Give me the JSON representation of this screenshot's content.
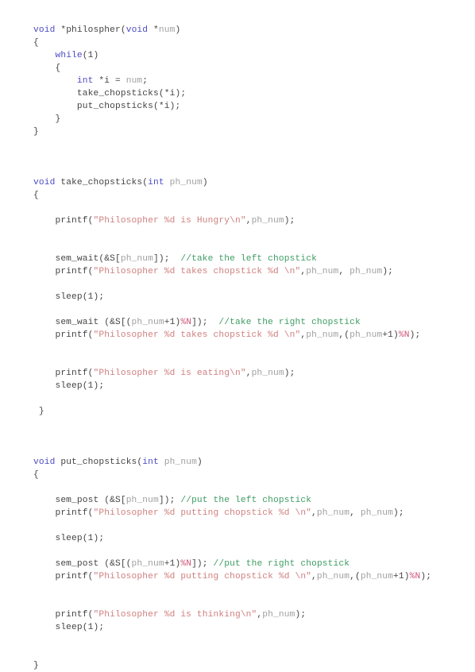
{
  "document": {
    "type": "source-code-listing",
    "language": "C",
    "topic": "Dining Philosophers problem",
    "background_color": "#ffffff",
    "syntax_colors": {
      "keyword": "#4b4bc4",
      "string": "#d08080",
      "comment": "#3e9c63",
      "identifier": "#a0a0a0",
      "plain": "#444444",
      "macro": "#cc5577"
    },
    "font_size_px": 11,
    "line_height_px": 16
  },
  "code": {
    "lines": [
      {
        "id": "l1",
        "tokens": [
          {
            "t": "void",
            "c": "kw"
          },
          {
            "t": " *philospher(",
            "c": "plain"
          },
          {
            "t": "void",
            "c": "kw"
          },
          {
            "t": " *",
            "c": "plain"
          },
          {
            "t": "num",
            "c": "id"
          },
          {
            "t": ")",
            "c": "plain"
          }
        ]
      },
      {
        "id": "l2",
        "tokens": [
          {
            "t": "{",
            "c": "plain"
          }
        ]
      },
      {
        "id": "l3",
        "tokens": [
          {
            "t": "    ",
            "c": "plain"
          },
          {
            "t": "while",
            "c": "kw"
          },
          {
            "t": "(1)",
            "c": "plain"
          }
        ]
      },
      {
        "id": "l4",
        "tokens": [
          {
            "t": "    {",
            "c": "plain"
          }
        ]
      },
      {
        "id": "l5",
        "tokens": [
          {
            "t": "        ",
            "c": "plain"
          },
          {
            "t": "int",
            "c": "kw"
          },
          {
            "t": " *i = ",
            "c": "plain"
          },
          {
            "t": "num",
            "c": "id"
          },
          {
            "t": ";",
            "c": "plain"
          }
        ]
      },
      {
        "id": "l6",
        "tokens": [
          {
            "t": "        take_chopsticks(*i);",
            "c": "plain"
          }
        ]
      },
      {
        "id": "l7",
        "tokens": [
          {
            "t": "        put_chopsticks(*i);",
            "c": "plain"
          }
        ]
      },
      {
        "id": "l8",
        "tokens": [
          {
            "t": "    }",
            "c": "plain"
          }
        ]
      },
      {
        "id": "l9",
        "tokens": [
          {
            "t": "}",
            "c": "plain"
          }
        ]
      },
      {
        "id": "l10",
        "tokens": []
      },
      {
        "id": "l11",
        "tokens": []
      },
      {
        "id": "l12",
        "tokens": []
      },
      {
        "id": "l13",
        "tokens": [
          {
            "t": "void",
            "c": "kw"
          },
          {
            "t": " take_chopsticks(",
            "c": "plain"
          },
          {
            "t": "int",
            "c": "kw"
          },
          {
            "t": " ",
            "c": "plain"
          },
          {
            "t": "ph_num",
            "c": "id"
          },
          {
            "t": ")",
            "c": "plain"
          }
        ]
      },
      {
        "id": "l14",
        "tokens": [
          {
            "t": "{",
            "c": "plain"
          }
        ]
      },
      {
        "id": "l15",
        "tokens": []
      },
      {
        "id": "l16",
        "tokens": [
          {
            "t": "    printf(",
            "c": "plain"
          },
          {
            "t": "\"Philosopher %d is Hungry\\n\"",
            "c": "str"
          },
          {
            "t": ",",
            "c": "plain"
          },
          {
            "t": "ph_num",
            "c": "id"
          },
          {
            "t": ");",
            "c": "plain"
          }
        ]
      },
      {
        "id": "l17",
        "tokens": []
      },
      {
        "id": "l18",
        "tokens": []
      },
      {
        "id": "l19",
        "tokens": [
          {
            "t": "    sem_wait(&S[",
            "c": "plain"
          },
          {
            "t": "ph_num",
            "c": "id"
          },
          {
            "t": "]);  ",
            "c": "plain"
          },
          {
            "t": "//take the left chopstick",
            "c": "cmt"
          }
        ]
      },
      {
        "id": "l20",
        "tokens": [
          {
            "t": "    printf(",
            "c": "plain"
          },
          {
            "t": "\"Philosopher %d takes chopstick %d \\n\"",
            "c": "str"
          },
          {
            "t": ",",
            "c": "plain"
          },
          {
            "t": "ph_num",
            "c": "id"
          },
          {
            "t": ", ",
            "c": "plain"
          },
          {
            "t": "ph_num",
            "c": "id"
          },
          {
            "t": ");",
            "c": "plain"
          }
        ]
      },
      {
        "id": "l21",
        "tokens": []
      },
      {
        "id": "l22",
        "tokens": [
          {
            "t": "    sleep(1);",
            "c": "plain"
          }
        ]
      },
      {
        "id": "l23",
        "tokens": []
      },
      {
        "id": "l24",
        "tokens": [
          {
            "t": "    sem_wait (&S[(",
            "c": "plain"
          },
          {
            "t": "ph_num",
            "c": "id"
          },
          {
            "t": "+1)",
            "c": "plain"
          },
          {
            "t": "%N",
            "c": "macro"
          },
          {
            "t": "]);  ",
            "c": "plain"
          },
          {
            "t": "//take the right chopstick",
            "c": "cmt"
          }
        ]
      },
      {
        "id": "l25",
        "tokens": [
          {
            "t": "    printf(",
            "c": "plain"
          },
          {
            "t": "\"Philosopher %d takes chopstick %d \\n\"",
            "c": "str"
          },
          {
            "t": ",",
            "c": "plain"
          },
          {
            "t": "ph_num",
            "c": "id"
          },
          {
            "t": ",(",
            "c": "plain"
          },
          {
            "t": "ph_num",
            "c": "id"
          },
          {
            "t": "+1)",
            "c": "plain"
          },
          {
            "t": "%N",
            "c": "macro"
          },
          {
            "t": ");",
            "c": "plain"
          }
        ]
      },
      {
        "id": "l26",
        "tokens": []
      },
      {
        "id": "l27",
        "tokens": []
      },
      {
        "id": "l28",
        "tokens": [
          {
            "t": "    printf(",
            "c": "plain"
          },
          {
            "t": "\"Philosopher %d is eating\\n\"",
            "c": "str"
          },
          {
            "t": ",",
            "c": "plain"
          },
          {
            "t": "ph_num",
            "c": "id"
          },
          {
            "t": ");",
            "c": "plain"
          }
        ]
      },
      {
        "id": "l29",
        "tokens": [
          {
            "t": "    sleep(1);",
            "c": "plain"
          }
        ]
      },
      {
        "id": "l30",
        "tokens": []
      },
      {
        "id": "l31",
        "tokens": [
          {
            "t": " }",
            "c": "plain"
          }
        ]
      },
      {
        "id": "l32",
        "tokens": []
      },
      {
        "id": "l33",
        "tokens": []
      },
      {
        "id": "l34",
        "tokens": []
      },
      {
        "id": "l35",
        "tokens": [
          {
            "t": "void",
            "c": "kw"
          },
          {
            "t": " put_chopsticks(",
            "c": "plain"
          },
          {
            "t": "int",
            "c": "kw"
          },
          {
            "t": " ",
            "c": "plain"
          },
          {
            "t": "ph_num",
            "c": "id"
          },
          {
            "t": ")",
            "c": "plain"
          }
        ]
      },
      {
        "id": "l36",
        "tokens": [
          {
            "t": "{",
            "c": "plain"
          }
        ]
      },
      {
        "id": "l37",
        "tokens": []
      },
      {
        "id": "l38",
        "tokens": [
          {
            "t": "    sem_post (&S[",
            "c": "plain"
          },
          {
            "t": "ph_num",
            "c": "id"
          },
          {
            "t": "]); ",
            "c": "plain"
          },
          {
            "t": "//put the left chopstick",
            "c": "cmt"
          }
        ]
      },
      {
        "id": "l39",
        "tokens": [
          {
            "t": "    printf(",
            "c": "plain"
          },
          {
            "t": "\"Philosopher %d putting chopstick %d \\n\"",
            "c": "str"
          },
          {
            "t": ",",
            "c": "plain"
          },
          {
            "t": "ph_num",
            "c": "id"
          },
          {
            "t": ", ",
            "c": "plain"
          },
          {
            "t": "ph_num",
            "c": "id"
          },
          {
            "t": ");",
            "c": "plain"
          }
        ]
      },
      {
        "id": "l40",
        "tokens": []
      },
      {
        "id": "l41",
        "tokens": [
          {
            "t": "    sleep(1);",
            "c": "plain"
          }
        ]
      },
      {
        "id": "l42",
        "tokens": []
      },
      {
        "id": "l43",
        "tokens": [
          {
            "t": "    sem_post (&S[(",
            "c": "plain"
          },
          {
            "t": "ph_num",
            "c": "id"
          },
          {
            "t": "+1)",
            "c": "plain"
          },
          {
            "t": "%N",
            "c": "macro"
          },
          {
            "t": "]); ",
            "c": "plain"
          },
          {
            "t": "//put the right chopstick",
            "c": "cmt"
          }
        ]
      },
      {
        "id": "l44",
        "tokens": [
          {
            "t": "    printf(",
            "c": "plain"
          },
          {
            "t": "\"Philosopher %d putting chopstick %d \\n\"",
            "c": "str"
          },
          {
            "t": ",",
            "c": "plain"
          },
          {
            "t": "ph_num",
            "c": "id"
          },
          {
            "t": ",(",
            "c": "plain"
          },
          {
            "t": "ph_num",
            "c": "id"
          },
          {
            "t": "+1)",
            "c": "plain"
          },
          {
            "t": "%N",
            "c": "macro"
          },
          {
            "t": ");",
            "c": "plain"
          }
        ]
      },
      {
        "id": "l45",
        "tokens": []
      },
      {
        "id": "l46",
        "tokens": []
      },
      {
        "id": "l47",
        "tokens": [
          {
            "t": "    printf(",
            "c": "plain"
          },
          {
            "t": "\"Philosopher %d is thinking\\n\"",
            "c": "str"
          },
          {
            "t": ",",
            "c": "plain"
          },
          {
            "t": "ph_num",
            "c": "id"
          },
          {
            "t": ");",
            "c": "plain"
          }
        ]
      },
      {
        "id": "l48",
        "tokens": [
          {
            "t": "    sleep(1);",
            "c": "plain"
          }
        ]
      },
      {
        "id": "l49",
        "tokens": []
      },
      {
        "id": "l50",
        "tokens": []
      },
      {
        "id": "l51",
        "tokens": [
          {
            "t": "}",
            "c": "plain"
          }
        ]
      }
    ]
  }
}
